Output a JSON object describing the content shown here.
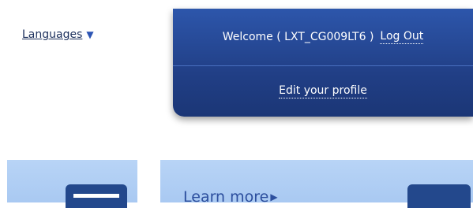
{
  "header": {
    "languages_label": "Languages",
    "languages_caret": "▼"
  },
  "account_menu": {
    "welcome_text": "Welcome ( LXT_CG009LT6 )",
    "logout_label": "Log Out",
    "edit_profile_label": "Edit your profile"
  },
  "promo": {
    "learn_more_label": "Learn more",
    "learn_more_arrow": "▶"
  },
  "colors": {
    "panel_blue": "#213f86",
    "tile_blue": "#a9c9f2",
    "link_dark": "#1b2f5c"
  },
  "icons": [
    "caret-down-icon",
    "card-icon",
    "arrow-right-icon",
    "tile-icon"
  ]
}
